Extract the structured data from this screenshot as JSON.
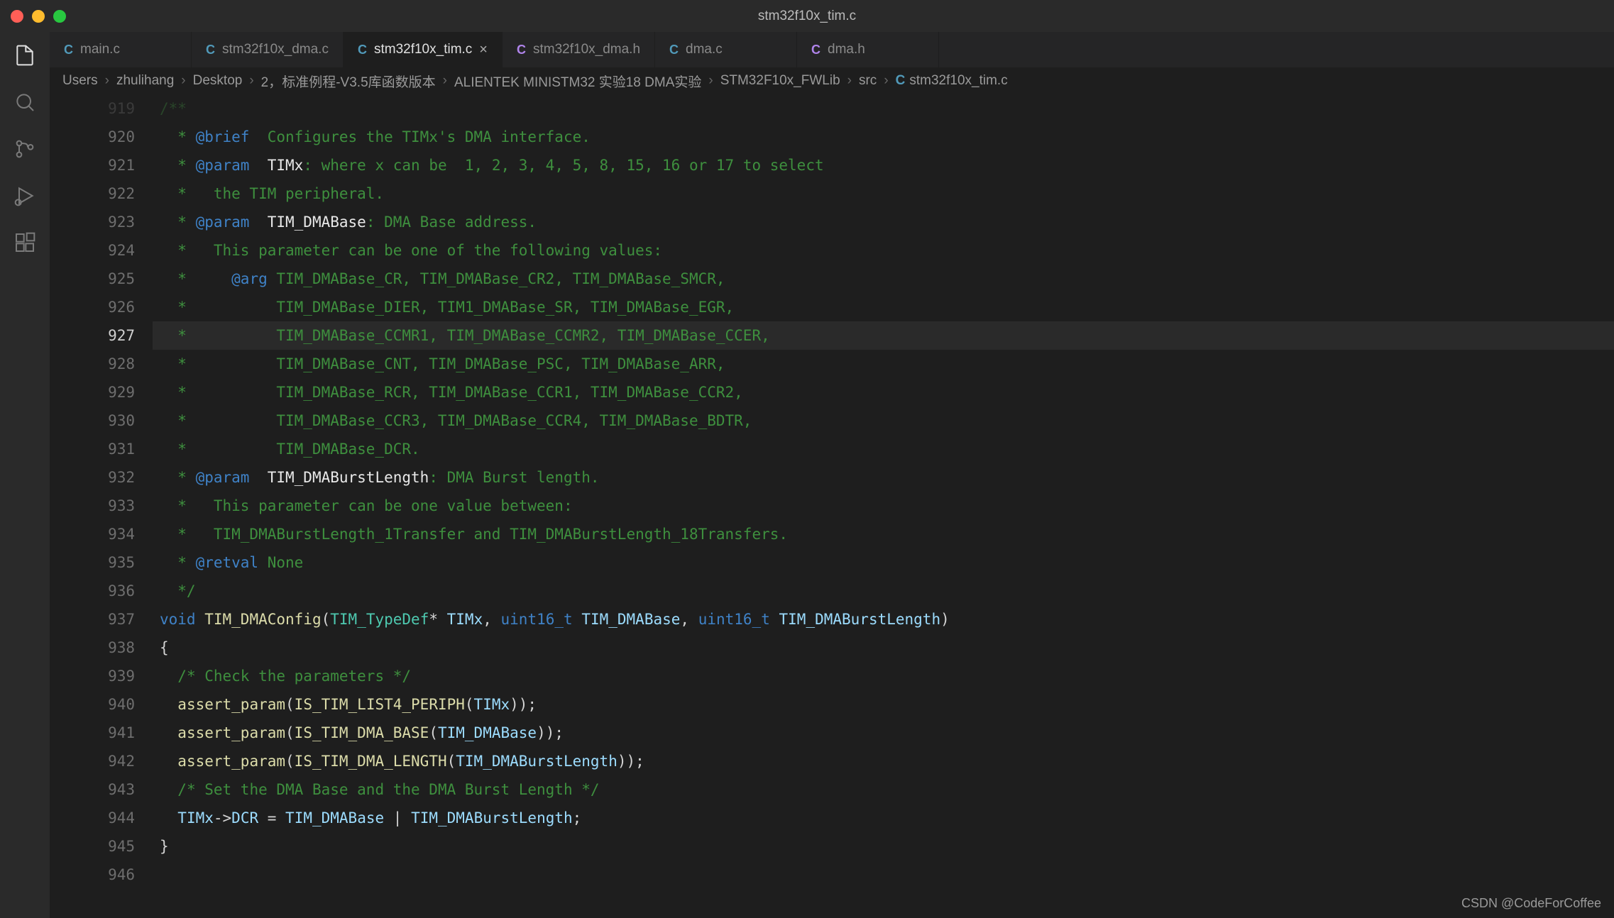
{
  "window": {
    "title": "stm32f10x_tim.c"
  },
  "tabs": [
    {
      "icon": "C",
      "iconType": "source",
      "label": "main.c",
      "active": false
    },
    {
      "icon": "C",
      "iconType": "source",
      "label": "stm32f10x_dma.c",
      "active": false
    },
    {
      "icon": "C",
      "iconType": "source",
      "label": "stm32f10x_tim.c",
      "active": true
    },
    {
      "icon": "C",
      "iconType": "header",
      "label": "stm32f10x_dma.h",
      "active": false
    },
    {
      "icon": "C",
      "iconType": "source",
      "label": "dma.c",
      "active": false
    },
    {
      "icon": "C",
      "iconType": "header",
      "label": "dma.h",
      "active": false
    }
  ],
  "breadcrumbs": {
    "segments": [
      "Users",
      "zhulihang",
      "Desktop",
      "2，标准例程-V3.5库函数版本",
      "ALIENTEK MINISTM32 实验18 DMA实验",
      "STM32F10x_FWLib",
      "src"
    ],
    "fileIcon": "C",
    "file": "stm32f10x_tim.c"
  },
  "editor": {
    "startLine": 919,
    "currentLine": 927,
    "lines": [
      {
        "n": 919,
        "segs": [
          {
            "t": "/**",
            "c": "c-comment"
          }
        ],
        "faded": true
      },
      {
        "n": 920,
        "segs": [
          {
            "t": "  * ",
            "c": "c-comment"
          },
          {
            "t": "@brief",
            "c": "c-docTagKey"
          },
          {
            "t": "  Configures the TIMx's DMA interface.",
            "c": "c-comment"
          }
        ]
      },
      {
        "n": 921,
        "segs": [
          {
            "t": "  * ",
            "c": "c-comment"
          },
          {
            "t": "@param",
            "c": "c-docTagKey"
          },
          {
            "t": "  ",
            "c": "c-comment"
          },
          {
            "t": "TIMx",
            "c": "c-docParam"
          },
          {
            "t": ": where x can be  1, 2, 3, 4, 5, 8, 15, 16 or 17 to select",
            "c": "c-comment"
          }
        ]
      },
      {
        "n": 922,
        "segs": [
          {
            "t": "  *   the TIM peripheral.",
            "c": "c-comment"
          }
        ]
      },
      {
        "n": 923,
        "segs": [
          {
            "t": "  * ",
            "c": "c-comment"
          },
          {
            "t": "@param",
            "c": "c-docTagKey"
          },
          {
            "t": "  ",
            "c": "c-comment"
          },
          {
            "t": "TIM_DMABase",
            "c": "c-docParam"
          },
          {
            "t": ": DMA Base address.",
            "c": "c-comment"
          }
        ]
      },
      {
        "n": 924,
        "segs": [
          {
            "t": "  *   This parameter can be one of the following values:",
            "c": "c-comment"
          }
        ]
      },
      {
        "n": 925,
        "segs": [
          {
            "t": "  *     ",
            "c": "c-comment"
          },
          {
            "t": "@arg",
            "c": "c-docTagKey"
          },
          {
            "t": " TIM_DMABase_CR, TIM_DMABase_CR2, TIM_DMABase_SMCR,",
            "c": "c-comment"
          }
        ]
      },
      {
        "n": 926,
        "segs": [
          {
            "t": "  *          TIM_DMABase_DIER, TIM1_DMABase_SR, TIM_DMABase_EGR,",
            "c": "c-comment"
          }
        ]
      },
      {
        "n": 927,
        "segs": [
          {
            "t": "  *          TIM_DMABase_CCMR1, TIM_DMABase_CCMR2, TIM_DMABase_CCER,",
            "c": "c-comment"
          }
        ],
        "highlight": true
      },
      {
        "n": 928,
        "segs": [
          {
            "t": "  *          TIM_DMABase_CNT, TIM_DMABase_PSC, TIM_DMABase_ARR,",
            "c": "c-comment"
          }
        ]
      },
      {
        "n": 929,
        "segs": [
          {
            "t": "  *          TIM_DMABase_RCR, TIM_DMABase_CCR1, TIM_DMABase_CCR2,",
            "c": "c-comment"
          }
        ]
      },
      {
        "n": 930,
        "segs": [
          {
            "t": "  *          TIM_DMABase_CCR3, TIM_DMABase_CCR4, TIM_DMABase_BDTR,",
            "c": "c-comment"
          }
        ]
      },
      {
        "n": 931,
        "segs": [
          {
            "t": "  *          TIM_DMABase_DCR.",
            "c": "c-comment"
          }
        ]
      },
      {
        "n": 932,
        "segs": [
          {
            "t": "  * ",
            "c": "c-comment"
          },
          {
            "t": "@param",
            "c": "c-docTagKey"
          },
          {
            "t": "  ",
            "c": "c-comment"
          },
          {
            "t": "TIM_DMABurstLength",
            "c": "c-docParam"
          },
          {
            "t": ": DMA Burst length.",
            "c": "c-comment"
          }
        ]
      },
      {
        "n": 933,
        "segs": [
          {
            "t": "  *   This parameter can be one value between:",
            "c": "c-comment"
          }
        ]
      },
      {
        "n": 934,
        "segs": [
          {
            "t": "  *   TIM_DMABurstLength_1Transfer and TIM_DMABurstLength_18Transfers.",
            "c": "c-comment"
          }
        ]
      },
      {
        "n": 935,
        "segs": [
          {
            "t": "  * ",
            "c": "c-comment"
          },
          {
            "t": "@retval",
            "c": "c-docTagKey"
          },
          {
            "t": " None",
            "c": "c-comment"
          }
        ]
      },
      {
        "n": 936,
        "segs": [
          {
            "t": "  */",
            "c": "c-comment"
          }
        ]
      },
      {
        "n": 937,
        "segs": [
          {
            "t": "void",
            "c": "c-keyword"
          },
          {
            "t": " ",
            "c": "c-plain"
          },
          {
            "t": "TIM_DMAConfig",
            "c": "c-func"
          },
          {
            "t": "(",
            "c": "c-punct"
          },
          {
            "t": "TIM_TypeDef",
            "c": "c-type"
          },
          {
            "t": "* ",
            "c": "c-punct"
          },
          {
            "t": "TIMx",
            "c": "c-var"
          },
          {
            "t": ", ",
            "c": "c-punct"
          },
          {
            "t": "uint16_t",
            "c": "c-keyword"
          },
          {
            "t": " ",
            "c": "c-plain"
          },
          {
            "t": "TIM_DMABase",
            "c": "c-var"
          },
          {
            "t": ", ",
            "c": "c-punct"
          },
          {
            "t": "uint16_t",
            "c": "c-keyword"
          },
          {
            "t": " ",
            "c": "c-plain"
          },
          {
            "t": "TIM_DMABurstLength",
            "c": "c-var"
          },
          {
            "t": ")",
            "c": "c-punct"
          }
        ]
      },
      {
        "n": 938,
        "segs": [
          {
            "t": "{",
            "c": "c-punct"
          }
        ]
      },
      {
        "n": 939,
        "segs": [
          {
            "t": "  ",
            "c": "c-plain"
          },
          {
            "t": "/* Check the parameters */",
            "c": "c-comment"
          }
        ]
      },
      {
        "n": 940,
        "segs": [
          {
            "t": "  ",
            "c": "c-plain"
          },
          {
            "t": "assert_param",
            "c": "c-func"
          },
          {
            "t": "(",
            "c": "c-punct"
          },
          {
            "t": "IS_TIM_LIST4_PERIPH",
            "c": "c-func"
          },
          {
            "t": "(",
            "c": "c-punct"
          },
          {
            "t": "TIMx",
            "c": "c-var"
          },
          {
            "t": "));",
            "c": "c-punct"
          }
        ]
      },
      {
        "n": 941,
        "segs": [
          {
            "t": "  ",
            "c": "c-plain"
          },
          {
            "t": "assert_param",
            "c": "c-func"
          },
          {
            "t": "(",
            "c": "c-punct"
          },
          {
            "t": "IS_TIM_DMA_BASE",
            "c": "c-func"
          },
          {
            "t": "(",
            "c": "c-punct"
          },
          {
            "t": "TIM_DMABase",
            "c": "c-var"
          },
          {
            "t": "));",
            "c": "c-punct"
          }
        ]
      },
      {
        "n": 942,
        "segs": [
          {
            "t": "  ",
            "c": "c-plain"
          },
          {
            "t": "assert_param",
            "c": "c-func"
          },
          {
            "t": "(",
            "c": "c-punct"
          },
          {
            "t": "IS_TIM_DMA_LENGTH",
            "c": "c-func"
          },
          {
            "t": "(",
            "c": "c-punct"
          },
          {
            "t": "TIM_DMABurstLength",
            "c": "c-var"
          },
          {
            "t": "));",
            "c": "c-punct"
          }
        ]
      },
      {
        "n": 943,
        "segs": [
          {
            "t": "  ",
            "c": "c-plain"
          },
          {
            "t": "/* Set the DMA Base and the DMA Burst Length */",
            "c": "c-comment"
          }
        ]
      },
      {
        "n": 944,
        "segs": [
          {
            "t": "  ",
            "c": "c-plain"
          },
          {
            "t": "TIMx",
            "c": "c-var"
          },
          {
            "t": "->",
            "c": "c-op"
          },
          {
            "t": "DCR",
            "c": "c-var"
          },
          {
            "t": " = ",
            "c": "c-op"
          },
          {
            "t": "TIM_DMABase",
            "c": "c-var"
          },
          {
            "t": " | ",
            "c": "c-op"
          },
          {
            "t": "TIM_DMABurstLength",
            "c": "c-var"
          },
          {
            "t": ";",
            "c": "c-punct"
          }
        ]
      },
      {
        "n": 945,
        "segs": [
          {
            "t": "}",
            "c": "c-punct"
          }
        ]
      },
      {
        "n": 946,
        "segs": []
      }
    ]
  },
  "watermark": "CSDN @CodeForCoffee"
}
